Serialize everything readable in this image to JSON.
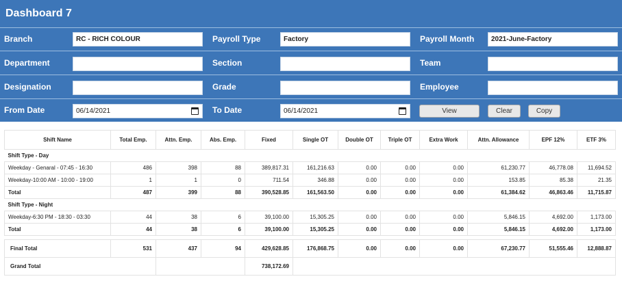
{
  "title": "Dashboard 7",
  "filters": {
    "branch_label": "Branch",
    "branch_value": "RC - RICH COLOUR",
    "payroll_type_label": "Payroll Type",
    "payroll_type_value": "Factory",
    "payroll_month_label": "Payroll Month",
    "payroll_month_value": "2021-June-Factory",
    "department_label": "Department",
    "department_value": "",
    "section_label": "Section",
    "section_value": "",
    "team_label": "Team",
    "team_value": "",
    "designation_label": "Designation",
    "designation_value": "",
    "grade_label": "Grade",
    "grade_value": "",
    "employee_label": "Employee",
    "employee_value": "",
    "from_date_label": "From Date",
    "from_date_value": "06/14/2021",
    "to_date_label": "To Date",
    "to_date_value": "06/14/2021"
  },
  "buttons": {
    "view": "View",
    "clear": "Clear",
    "copy": "Copy"
  },
  "table": {
    "headers": [
      "Shift Name",
      "Total Emp.",
      "Attn. Emp.",
      "Abs. Emp.",
      "Fixed",
      "Single OT",
      "Double OT",
      "Triple OT",
      "Extra Work",
      "Attn. Allowance",
      "EPF 12%",
      "ETF 3%"
    ],
    "day_section": "Shift Type - Day",
    "day_rows": [
      [
        "Weekday - Genaral - 07:45 - 16:30",
        "486",
        "398",
        "88",
        "389,817.31",
        "161,216.63",
        "0.00",
        "0.00",
        "0.00",
        "61,230.77",
        "46,778.08",
        "11,694.52"
      ],
      [
        "Weekday-10:00 AM - 10:00 - 19:00",
        "1",
        "1",
        "0",
        "711.54",
        "346.88",
        "0.00",
        "0.00",
        "0.00",
        "153.85",
        "85.38",
        "21.35"
      ]
    ],
    "day_total": [
      "Total",
      "487",
      "399",
      "88",
      "390,528.85",
      "161,563.50",
      "0.00",
      "0.00",
      "0.00",
      "61,384.62",
      "46,863.46",
      "11,715.87"
    ],
    "night_section": "Shift Type - Night",
    "night_rows": [
      [
        "Weekday-6:30 PM - 18:30 - 03:30",
        "44",
        "38",
        "6",
        "39,100.00",
        "15,305.25",
        "0.00",
        "0.00",
        "0.00",
        "5,846.15",
        "4,692.00",
        "1,173.00"
      ]
    ],
    "night_total": [
      "Total",
      "44",
      "38",
      "6",
      "39,100.00",
      "15,305.25",
      "0.00",
      "0.00",
      "0.00",
      "5,846.15",
      "4,692.00",
      "1,173.00"
    ],
    "final_total": [
      "Final Total",
      "531",
      "437",
      "94",
      "429,628.85",
      "176,868.75",
      "0.00",
      "0.00",
      "0.00",
      "67,230.77",
      "51,555.46",
      "12,888.87"
    ],
    "grand_total_label": "Grand Total",
    "grand_total_value": "738,172.69"
  }
}
